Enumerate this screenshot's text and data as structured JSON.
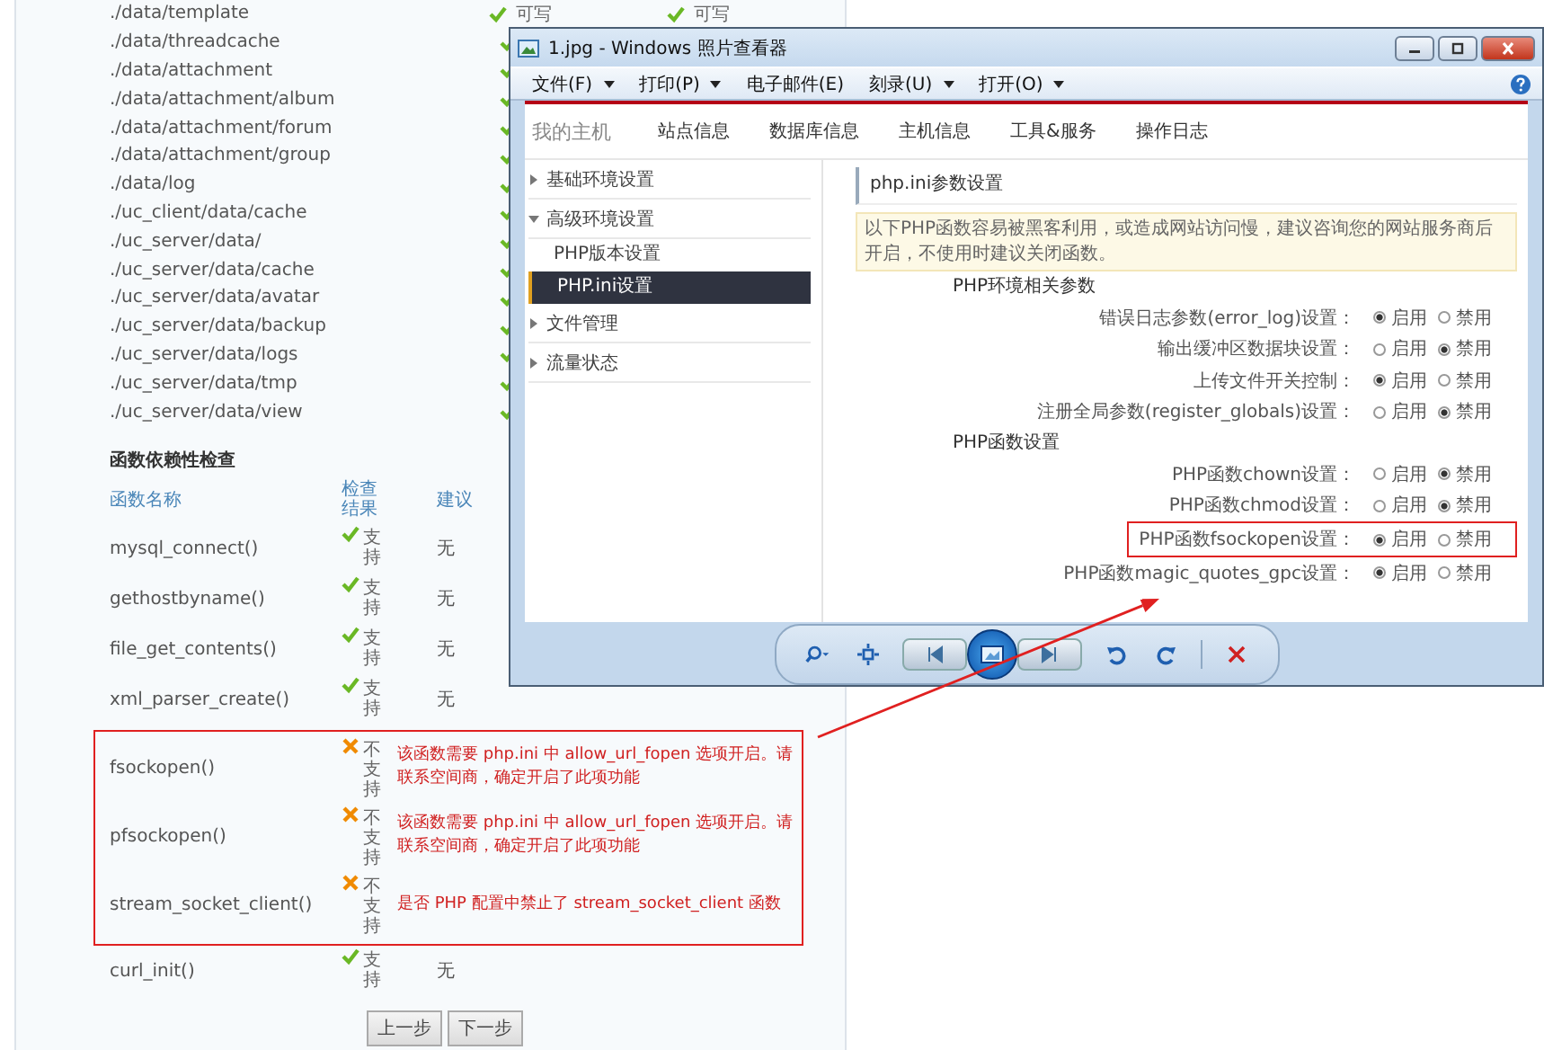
{
  "directories": [
    {
      "path": "./data/template",
      "states": [
        {
          "ok": true,
          "text": "可写"
        },
        {
          "ok": true,
          "text": "可写"
        }
      ]
    },
    {
      "path": "./data/threadcache",
      "states": [
        {
          "ok": true
        }
      ]
    },
    {
      "path": "./data/attachment",
      "states": [
        {
          "ok": true
        }
      ]
    },
    {
      "path": "./data/attachment/album",
      "states": [
        {
          "ok": true
        }
      ]
    },
    {
      "path": "./data/attachment/forum",
      "states": [
        {
          "ok": true
        }
      ]
    },
    {
      "path": "./data/attachment/group",
      "states": [
        {
          "ok": true
        }
      ]
    },
    {
      "path": "./data/log",
      "states": [
        {
          "ok": true
        }
      ]
    },
    {
      "path": "./uc_client/data/cache",
      "states": [
        {
          "ok": true
        }
      ]
    },
    {
      "path": "./uc_server/data/",
      "states": [
        {
          "ok": true
        }
      ]
    },
    {
      "path": "./uc_server/data/cache",
      "states": [
        {
          "ok": true
        }
      ]
    },
    {
      "path": "./uc_server/data/avatar",
      "states": [
        {
          "ok": true
        }
      ]
    },
    {
      "path": "./uc_server/data/backup",
      "states": [
        {
          "ok": true
        }
      ]
    },
    {
      "path": "./uc_server/data/logs",
      "states": [
        {
          "ok": true
        }
      ]
    },
    {
      "path": "./uc_server/data/tmp",
      "states": [
        {
          "ok": true
        }
      ]
    },
    {
      "path": "./uc_server/data/view",
      "states": [
        {
          "ok": true
        }
      ]
    }
  ],
  "function_check": {
    "title": "函数依赖性检查",
    "columns": [
      "函数名称",
      "检查结果",
      "建议"
    ],
    "rows": [
      {
        "name": "mysql_connect()",
        "supported": true,
        "result": "支持",
        "advice": "无"
      },
      {
        "name": "gethostbyname()",
        "supported": true,
        "result": "支持",
        "advice": "无"
      },
      {
        "name": "file_get_contents()",
        "supported": true,
        "result": "支持",
        "advice": "无"
      },
      {
        "name": "xml_parser_create()",
        "supported": true,
        "result": "支持",
        "advice": "无"
      }
    ],
    "highlighted_rows": [
      {
        "name": "fsockopen()",
        "supported": false,
        "result": "不支持",
        "advice": "该函数需要 php.ini 中 allow_url_fopen 选项开启。请联系空间商，确定开启了此项功能"
      },
      {
        "name": "pfsockopen()",
        "supported": false,
        "result": "不支持",
        "advice": "该函数需要 php.ini 中 allow_url_fopen 选项开启。请联系空间商，确定开启了此项功能"
      },
      {
        "name": "stream_socket_client()",
        "supported": false,
        "result": "不支持",
        "advice": "是否 PHP 配置中禁止了 stream_socket_client 函数"
      }
    ],
    "rows_after": [
      {
        "name": "curl_init()",
        "supported": true,
        "result": "支持",
        "advice": "无"
      }
    ]
  },
  "buttons": [
    "上一步",
    "下一步"
  ],
  "viewer": {
    "title": "1.jpg - Windows 照片查看器",
    "menu": [
      {
        "label": "文件(F)",
        "dropdown": true
      },
      {
        "label": "打印(P)",
        "dropdown": true
      },
      {
        "label": "电子邮件(E)",
        "dropdown": false
      },
      {
        "label": "刻录(U)",
        "dropdown": true
      },
      {
        "label": "打开(O)",
        "dropdown": true
      }
    ],
    "image": {
      "brand": "我的主机",
      "tabs": [
        "站点信息",
        "数据库信息",
        "主机信息",
        "工具&服务",
        "操作日志"
      ],
      "sidebar": [
        {
          "label": "基础环境设置",
          "expanded": false
        },
        {
          "label": "高级环境设置",
          "expanded": true,
          "children": [
            {
              "label": "PHP版本设置",
              "selected": false
            },
            {
              "label": "PHP.ini设置",
              "selected": true
            }
          ]
        },
        {
          "label": "文件管理",
          "expanded": false
        },
        {
          "label": "流量状态",
          "expanded": false
        }
      ],
      "heading": "php.ini参数设置",
      "notice": "以下PHP函数容易被黑客利用，或造成网站访问慢，建议咨询您的网站服务商后开启，不使用时建议关闭函数。",
      "sections": [
        {
          "title": "PHP环境相关参数",
          "settings": [
            {
              "label": "错误日志参数(error_log)设置：",
              "highlighted": false,
              "options": [
                {
                  "label": "启用",
                  "selected": true
                },
                {
                  "label": "禁用",
                  "selected": false
                }
              ]
            },
            {
              "label": "输出缓冲区数据块设置：",
              "highlighted": false,
              "options": [
                {
                  "label": "启用",
                  "selected": false
                },
                {
                  "label": "禁用",
                  "selected": true
                }
              ]
            },
            {
              "label": "上传文件开关控制：",
              "highlighted": false,
              "options": [
                {
                  "label": "启用",
                  "selected": true
                },
                {
                  "label": "禁用",
                  "selected": false
                }
              ]
            },
            {
              "label": "注册全局参数(register_globals)设置：",
              "highlighted": false,
              "options": [
                {
                  "label": "启用",
                  "selected": false
                },
                {
                  "label": "禁用",
                  "selected": true
                }
              ]
            }
          ]
        },
        {
          "title": "PHP函数设置",
          "settings": [
            {
              "label": "PHP函数chown设置：",
              "highlighted": false,
              "options": [
                {
                  "label": "启用",
                  "selected": false
                },
                {
                  "label": "禁用",
                  "selected": true
                }
              ]
            },
            {
              "label": "PHP函数chmod设置：",
              "highlighted": false,
              "options": [
                {
                  "label": "启用",
                  "selected": false
                },
                {
                  "label": "禁用",
                  "selected": true
                }
              ]
            },
            {
              "label": "PHP函数fsockopen设置：",
              "highlighted": true,
              "options": [
                {
                  "label": "启用",
                  "selected": true
                },
                {
                  "label": "禁用",
                  "selected": false
                }
              ]
            },
            {
              "label": "PHP函数magic_quotes_gpc设置：",
              "highlighted": false,
              "options": [
                {
                  "label": "启用",
                  "selected": true
                },
                {
                  "label": "禁用",
                  "selected": false
                }
              ]
            }
          ]
        }
      ]
    }
  }
}
